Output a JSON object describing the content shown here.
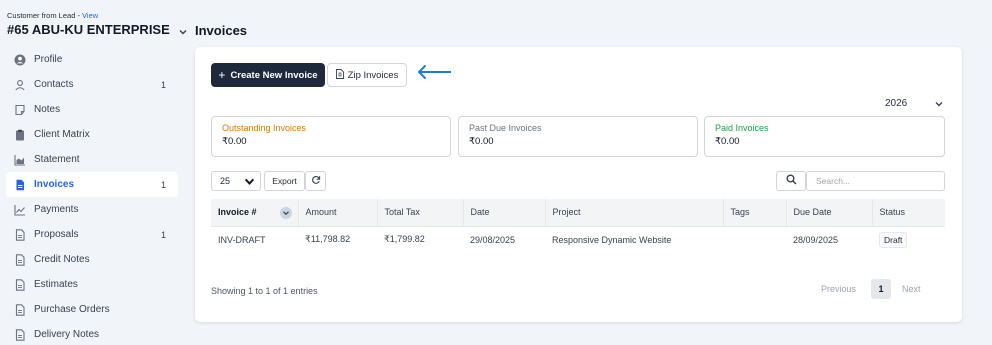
{
  "sidebar": {
    "breadcrumb_prefix": "Customer from Lead - ",
    "breadcrumb_link": "View",
    "customer_title": "#65 ABU-KU ENTERPRISE",
    "items": [
      {
        "label": "Profile",
        "icon": "user-circle-icon",
        "count": ""
      },
      {
        "label": "Contacts",
        "icon": "user-icon",
        "count": "1"
      },
      {
        "label": "Notes",
        "icon": "note-icon",
        "count": ""
      },
      {
        "label": "Client Matrix",
        "icon": "clipboard-icon",
        "count": ""
      },
      {
        "label": "Statement",
        "icon": "chart-area-icon",
        "count": ""
      },
      {
        "label": "Invoices",
        "icon": "file-invoice-icon",
        "count": "1",
        "active": true
      },
      {
        "label": "Payments",
        "icon": "line-chart-icon",
        "count": ""
      },
      {
        "label": "Proposals",
        "icon": "file-icon",
        "count": "1"
      },
      {
        "label": "Credit Notes",
        "icon": "file-icon",
        "count": ""
      },
      {
        "label": "Estimates",
        "icon": "file-icon",
        "count": ""
      },
      {
        "label": "Purchase Orders",
        "icon": "file-icon",
        "count": ""
      },
      {
        "label": "Delivery Notes",
        "icon": "file-icon",
        "count": ""
      }
    ]
  },
  "main": {
    "title": "Invoices",
    "create_button": "Create New Invoice",
    "zip_button": "Zip Invoices",
    "year": "2026",
    "stats": [
      {
        "label": "Outstanding Invoices",
        "value": "₹0.00"
      },
      {
        "label": "Past Due Invoices",
        "value": "₹0.00"
      },
      {
        "label": "Paid Invoices",
        "value": "₹0.00"
      }
    ],
    "page_size": "25",
    "export_button": "Export",
    "search_placeholder": "Search...",
    "columns": [
      "Invoice #",
      "Amount",
      "Total Tax",
      "Date",
      "Project",
      "Tags",
      "Due Date",
      "Status"
    ],
    "rows": [
      {
        "invoice": "INV-DRAFT",
        "amount": "₹11,798.82",
        "tax": "₹1,799.82",
        "date": "29/08/2025",
        "project": "Responsive Dynamic Website",
        "tags": "",
        "due": "28/09/2025",
        "status": "Draft"
      }
    ],
    "showing": "Showing 1 to 1 of 1 entries",
    "pagination": {
      "previous": "Previous",
      "current": "1",
      "next": "Next"
    }
  },
  "colors": {
    "accent": "#2563eb",
    "primary_button": "#1e293b",
    "outstanding": "#d97706",
    "paid": "#16a34a",
    "arrow": "#1d7ed6"
  }
}
